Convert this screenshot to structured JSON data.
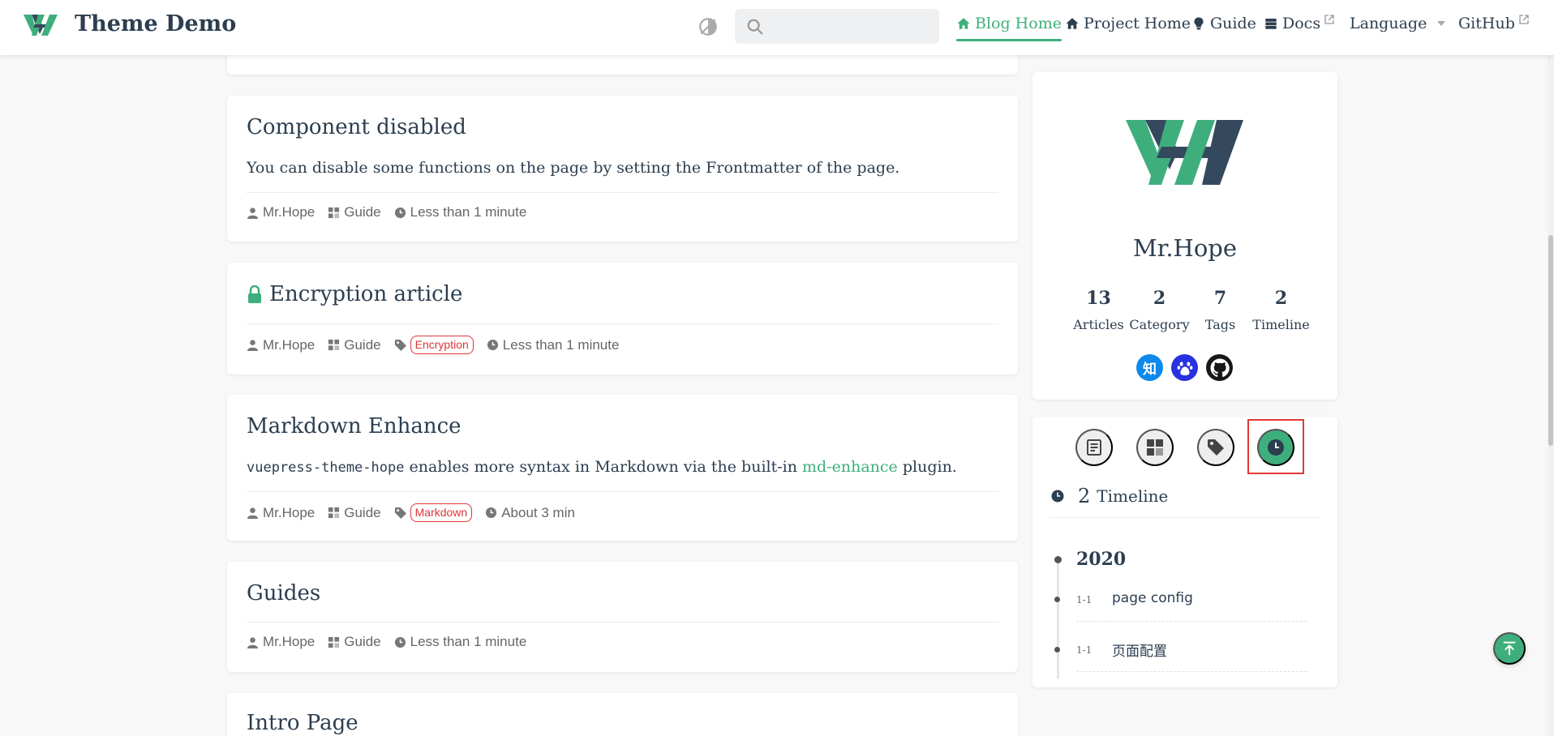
{
  "navbar": {
    "title": "Theme Demo",
    "search": {
      "value": "",
      "placeholder": ""
    },
    "items": [
      {
        "label": "Blog Home",
        "icon": "home-icon",
        "active": true
      },
      {
        "label": "Project Home",
        "icon": "home-icon",
        "active": false
      },
      {
        "label": "Guide",
        "icon": "lightbulb-icon",
        "active": false
      },
      {
        "label": "Docs",
        "icon": "book-icon",
        "external": true
      },
      {
        "label": "Language",
        "icon": "chevron-down-icon",
        "dropdown": true
      },
      {
        "label": "GitHub",
        "icon": "external-link-icon",
        "external": true
      }
    ]
  },
  "articles": [
    {
      "title": "Component disabled",
      "excerpt": "You can disable some functions on the page by setting the Frontmatter of the page.",
      "author": "Mr.Hope",
      "category": "Guide",
      "reading_time": "Less than 1 minute"
    },
    {
      "title": "Encryption article",
      "locked": true,
      "author": "Mr.Hope",
      "category": "Guide",
      "tag": "Encryption",
      "reading_time": "Less than 1 minute"
    },
    {
      "title": "Markdown Enhance",
      "excerpt_code": "vuepress-theme-hope",
      "excerpt_mid": " enables more syntax in Markdown via the built-in ",
      "excerpt_link": "md-enhance",
      "excerpt_end": " plugin.",
      "author": "Mr.Hope",
      "category": "Guide",
      "tag": "Markdown",
      "reading_time": "About 3 min"
    },
    {
      "title": "Guides",
      "author": "Mr.Hope",
      "category": "Guide",
      "reading_time": "Less than 1 minute"
    },
    {
      "title": "Intro Page"
    }
  ],
  "profile": {
    "name": "Mr.Hope",
    "stats": [
      {
        "value": "13",
        "label": "Articles"
      },
      {
        "value": "2",
        "label": "Category"
      },
      {
        "value": "7",
        "label": "Tags"
      },
      {
        "value": "2",
        "label": "Timeline"
      }
    ],
    "socials": [
      {
        "icon": "zhihu-icon",
        "label": "知",
        "color": "#0f88eb"
      },
      {
        "icon": "baidu-icon",
        "color": "#2932e1"
      },
      {
        "icon": "github-icon",
        "color": "#181717"
      }
    ]
  },
  "info_tabs": [
    {
      "icon": "article-list-icon",
      "active": false
    },
    {
      "icon": "category-icon",
      "active": false
    },
    {
      "icon": "tag-icon",
      "active": false
    },
    {
      "icon": "clock-icon",
      "active": true
    }
  ],
  "timeline": {
    "count": "2",
    "label": "Timeline",
    "year": "2020",
    "entries": [
      {
        "date": "1-1",
        "title": "page config"
      },
      {
        "date": "1-1",
        "title": "页面配置"
      }
    ]
  },
  "colors": {
    "accent": "#3eaf7c",
    "tag": "#e0343a",
    "highlight": "#e53935"
  }
}
